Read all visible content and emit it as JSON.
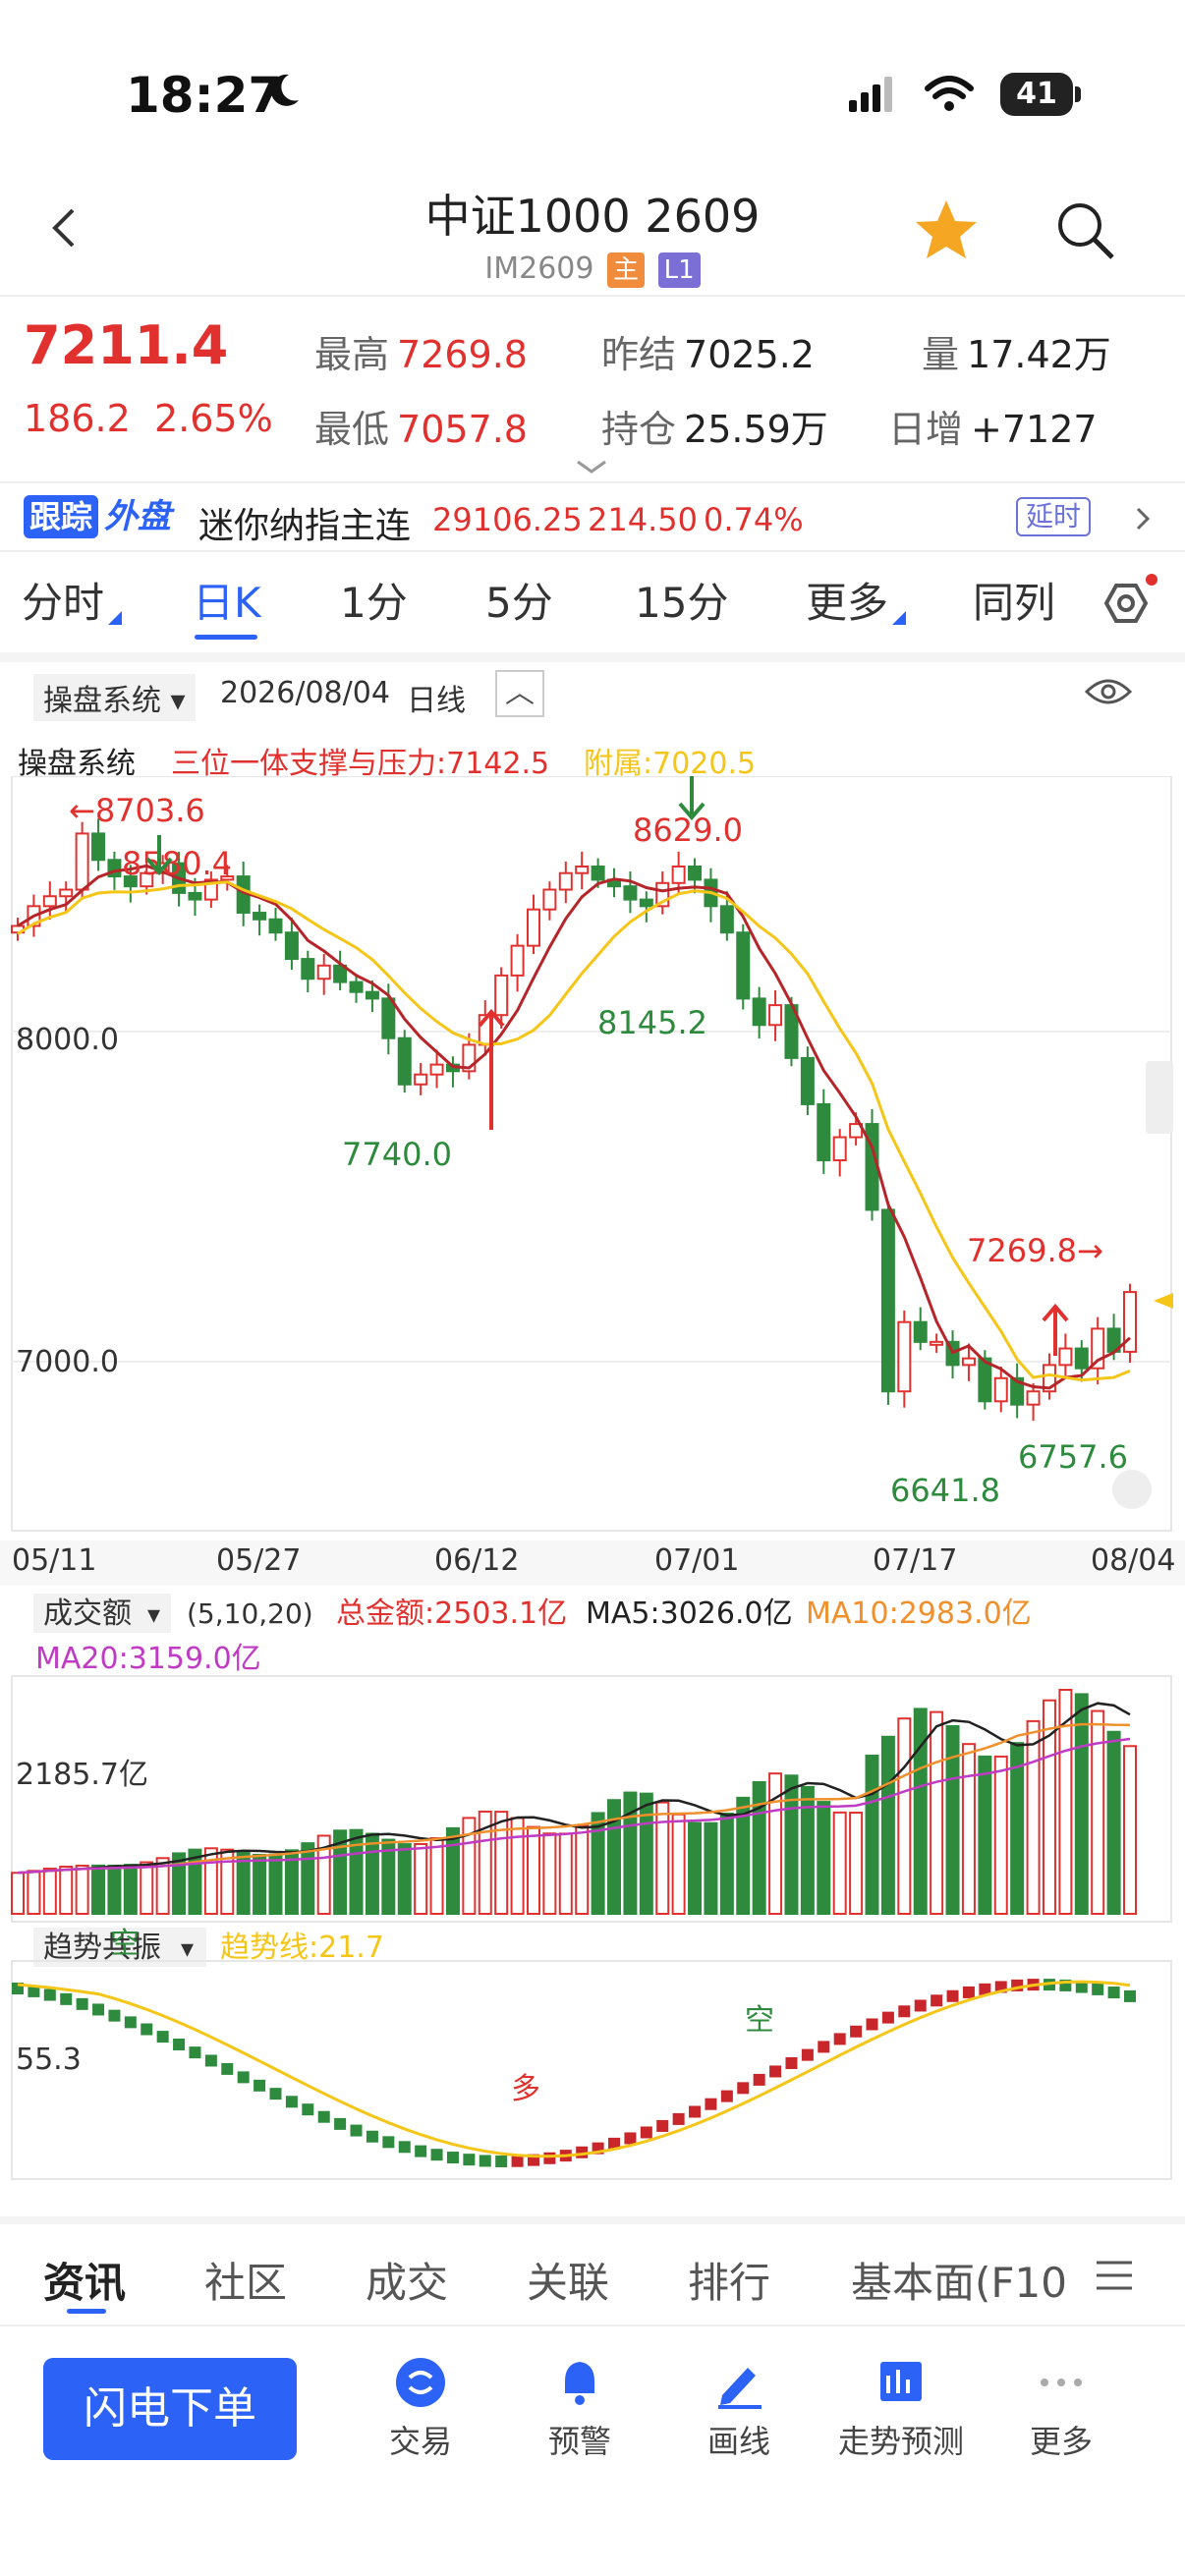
{
  "status": {
    "time": "18:27",
    "battery": "41"
  },
  "header": {
    "title": "中证1000 2609",
    "code": "IM2609",
    "tag_main": "主",
    "tag_level": "L1"
  },
  "quote": {
    "price": "7211.4",
    "change": "186.2",
    "change_pct": "2.65%",
    "high_label": "最高",
    "high": "7269.8",
    "low_label": "最低",
    "low": "7057.8",
    "prev_label": "昨结",
    "prev": "7025.2",
    "oi_label": "持仓",
    "oi": "25.59万",
    "vol_label": "量",
    "vol": "17.42万",
    "daily_label": "日增",
    "daily": "+7127"
  },
  "external": {
    "brand_a": "跟踪",
    "brand_b": "外盘",
    "name": "迷你纳指主连",
    "price": "29106.25",
    "change": "214.50",
    "pct": "0.74%",
    "delay_label": "延时"
  },
  "period_tabs": [
    "分时",
    "日K",
    "1分",
    "5分",
    "15分",
    "更多",
    "同列"
  ],
  "chart_toolbar": {
    "system": "操盘系统",
    "date": "2026/08/04",
    "period": "日线"
  },
  "indicator": {
    "name": "操盘系统",
    "support_label": "三位一体支撑与压力:7142.5",
    "attach_label": "附属:7020.5"
  },
  "price_chart": {
    "y_labels": [
      "8000.0",
      "7000.0"
    ],
    "x_labels": [
      "05/11",
      "05/27",
      "06/12",
      "07/01",
      "07/17",
      "08/04"
    ],
    "annotations": {
      "high1": "←8703.6",
      "high2": "8580.4",
      "high3": "8629.0",
      "low1": "7740.0",
      "low2": "8145.2",
      "low3": "6641.8",
      "low4": "6757.6",
      "last_high": "7269.8→"
    }
  },
  "volume": {
    "name": "成交额",
    "params": "(5,10,20)",
    "total": "总金额:2503.1亿",
    "ma5": "MA5:3026.0亿",
    "ma10": "MA10:2983.0亿",
    "ma20": "MA20:3159.0亿",
    "y_label": "2185.7亿"
  },
  "trend": {
    "name": "趋势共振",
    "line": "趋势线:21.7",
    "y_label": "55.3",
    "sig_kong1": "空",
    "sig_duo": "多",
    "sig_kong2": "空"
  },
  "bottom_tabs": [
    "资讯",
    "社区",
    "成交",
    "关联",
    "排行",
    "基本面(F10"
  ],
  "actions": {
    "flash_order": "闪电下单",
    "trade": "交易",
    "alert": "预警",
    "draw": "画线",
    "forecast": "走势预测",
    "more": "更多"
  },
  "chart_data": {
    "type": "candlestick",
    "x_ticks": [
      "05/11",
      "05/27",
      "06/12",
      "07/01",
      "07/17",
      "08/04"
    ],
    "y_ticks": [
      8000.0,
      7000.0
    ],
    "marked_values": {
      "highs": [
        8703.6,
        8580.4,
        8629.0,
        7269.8
      ],
      "lows": [
        7740.0,
        8145.2,
        6641.8,
        6757.6
      ]
    },
    "last_close": 7211.4,
    "volume_ma": {
      "MA5": 3026.0,
      "MA10": 2983.0,
      "MA20": 3159.0,
      "unit": "亿"
    },
    "trend_line": 21.7
  }
}
